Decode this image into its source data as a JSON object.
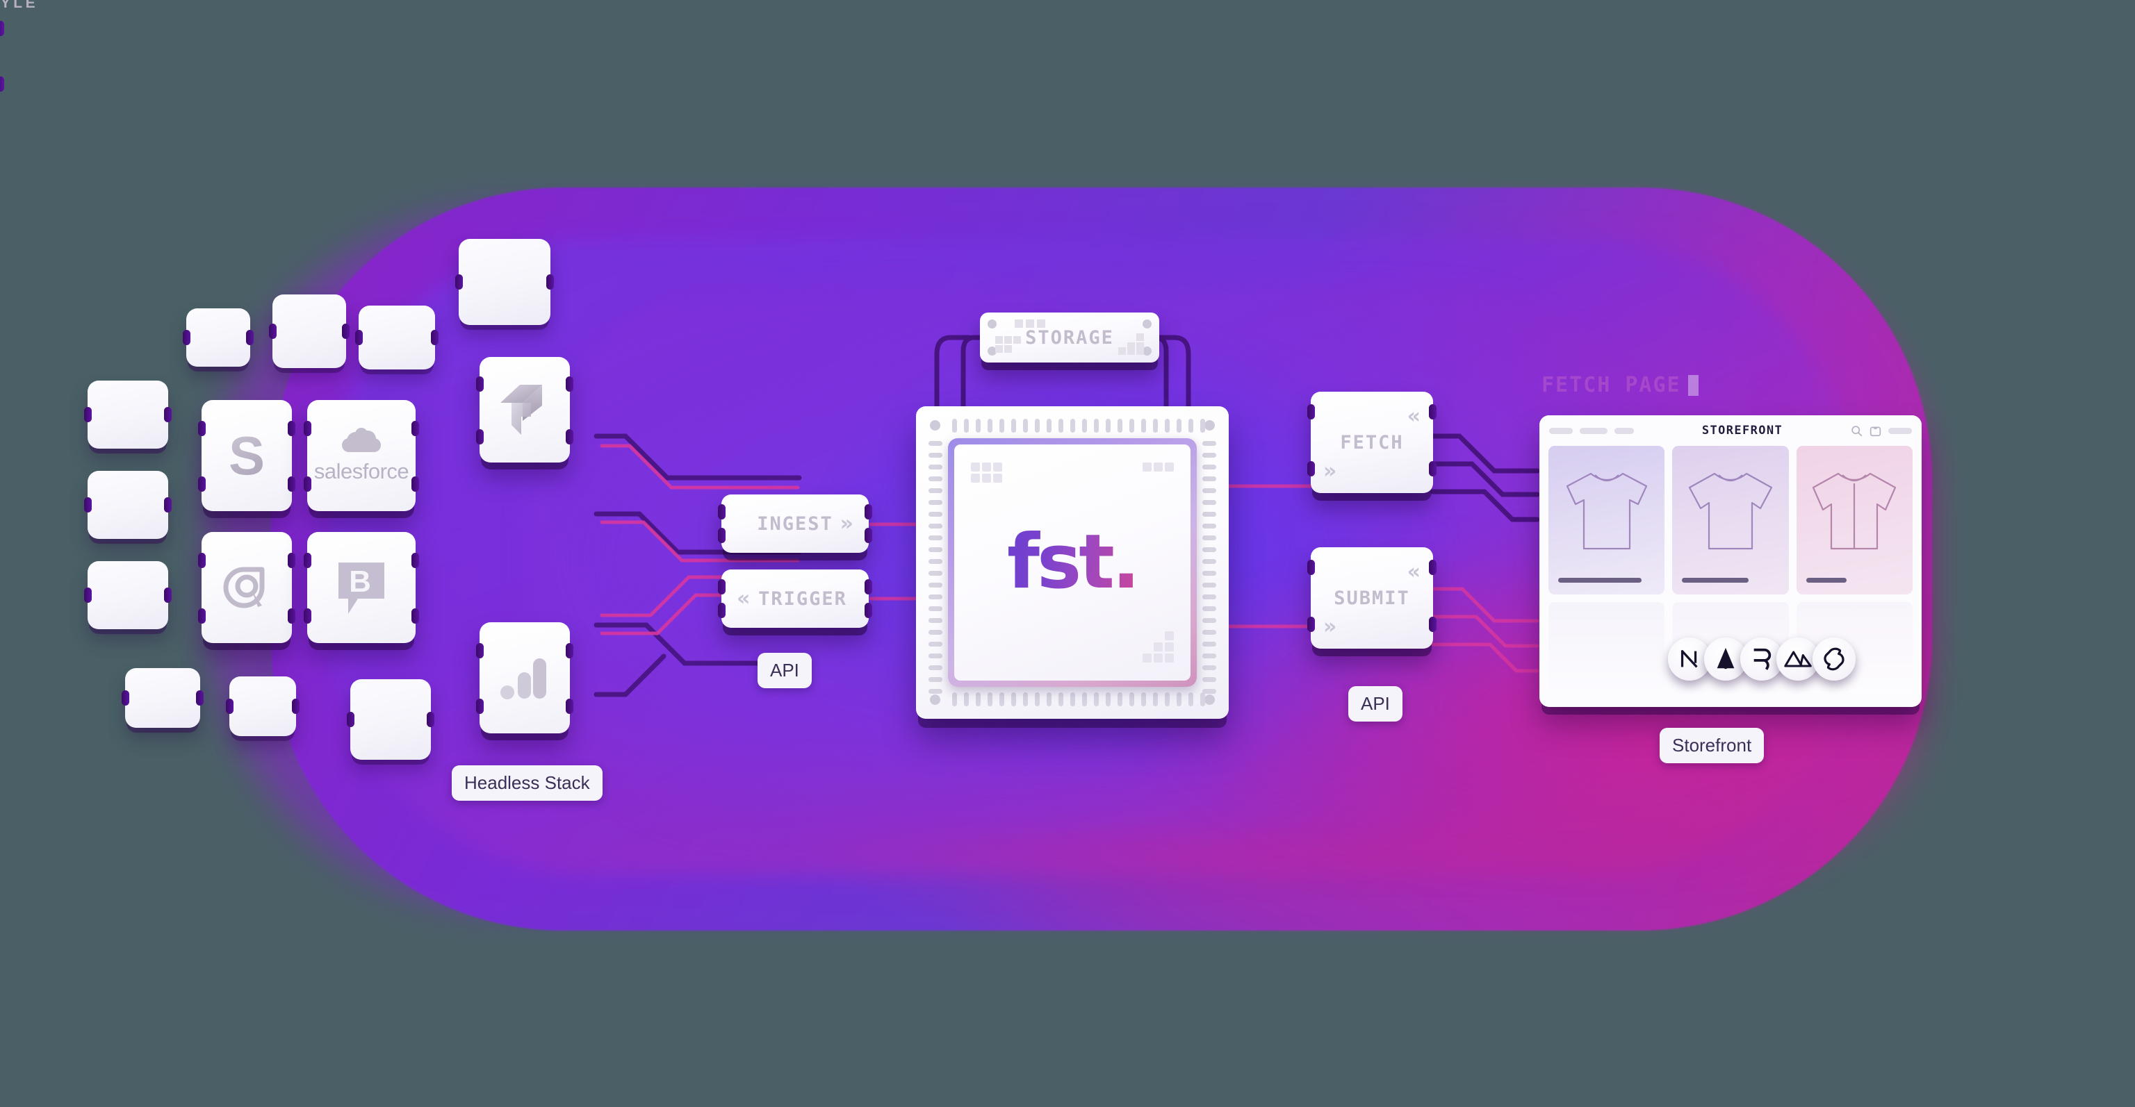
{
  "canvas": {
    "background": "#4a6066",
    "accent_purple": "#7b2fe0",
    "accent_magenta": "#c4268f"
  },
  "central_chip": {
    "wordmark": "fst.",
    "wordmark_gradient_from": "#6d3fd0",
    "wordmark_gradient_to": "#c9479b",
    "name": "fst-processor"
  },
  "storage": {
    "label": "STORAGE"
  },
  "left_stack": {
    "caption": "Headless Stack",
    "logos": [
      {
        "name": "shopify",
        "glyph": "S",
        "kind": "letter"
      },
      {
        "name": "salesforce",
        "glyph": "salesforce",
        "kind": "wordmark-cloud"
      },
      {
        "name": "contentful",
        "glyph": "",
        "kind": "arrow-mark"
      },
      {
        "name": "algolia",
        "glyph": "@",
        "kind": "letter"
      },
      {
        "name": "bazaarvoice",
        "glyph": "B",
        "kind": "speech-bubble"
      },
      {
        "name": "scayle",
        "glyph": "SCAYLE",
        "kind": "wordmark-ring"
      },
      {
        "name": "google-analytics",
        "glyph": "",
        "kind": "bars"
      }
    ],
    "placeholder_tile_count": 10
  },
  "ingress": {
    "caption": "API",
    "nodes": [
      {
        "label": "INGEST",
        "suffix_chevron": "»",
        "prefix_chevron": ""
      },
      {
        "label": "TRIGGER",
        "suffix_chevron": "",
        "prefix_chevron": "«"
      }
    ]
  },
  "egress": {
    "caption": "API",
    "nodes": [
      {
        "label": "FETCH",
        "chevron_tr": "«",
        "chevron_bl": "»"
      },
      {
        "label": "SUBMIT",
        "chevron_tr": "«",
        "chevron_bl": "»"
      }
    ]
  },
  "storefront": {
    "caption": "Storefront",
    "window_title": "STOREFRONT",
    "watermark": "FETCH PAGE",
    "header_icons": [
      "search-icon",
      "shopping-bag-icon"
    ],
    "nav_placeholders": 3,
    "products": [
      {
        "kind": "t-shirt",
        "tint": "#d6cdf0"
      },
      {
        "kind": "t-shirt",
        "tint": "#ddd0ee"
      },
      {
        "kind": "button-shirt",
        "tint": "#f0d3e6"
      }
    ],
    "frameworks": [
      {
        "name": "nextjs",
        "glyph": "N"
      },
      {
        "name": "astro",
        "glyph": "A"
      },
      {
        "name": "remix",
        "glyph": "R"
      },
      {
        "name": "nuxt",
        "glyph": "▲"
      },
      {
        "name": "svelte",
        "glyph": "S"
      }
    ]
  }
}
